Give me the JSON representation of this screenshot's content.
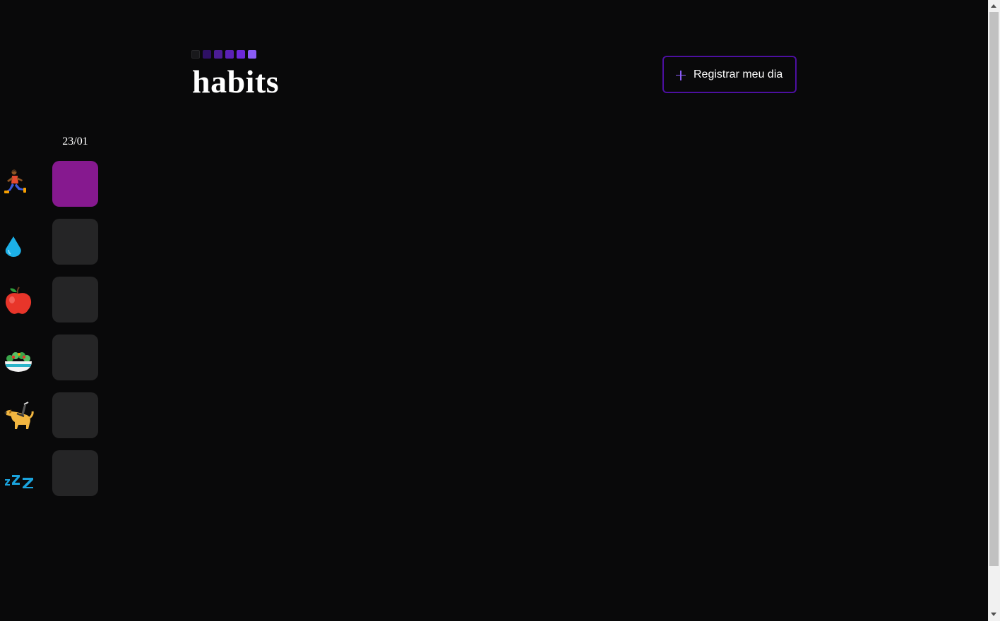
{
  "header": {
    "title": "habits",
    "logo_square_colors": [
      "#18181b",
      "#2e1065",
      "#4c1d95",
      "#5b21b6",
      "#6d28d9",
      "#8b5cf6"
    ],
    "register_button_label": "Registrar meu dia",
    "accent_color": "#8b5cf6",
    "button_border_color": "#4c0fa0"
  },
  "summary": {
    "date": "23/01",
    "habits": [
      {
        "icon": "runner-icon",
        "completed": true
      },
      {
        "icon": "water-drop-icon",
        "completed": false
      },
      {
        "icon": "apple-icon",
        "completed": false
      },
      {
        "icon": "salad-icon",
        "completed": false
      },
      {
        "icon": "guide-dog-icon",
        "completed": false
      },
      {
        "icon": "sleep-zzz-icon",
        "completed": false
      }
    ],
    "completed_color": "#86198f",
    "empty_color": "#252526"
  }
}
